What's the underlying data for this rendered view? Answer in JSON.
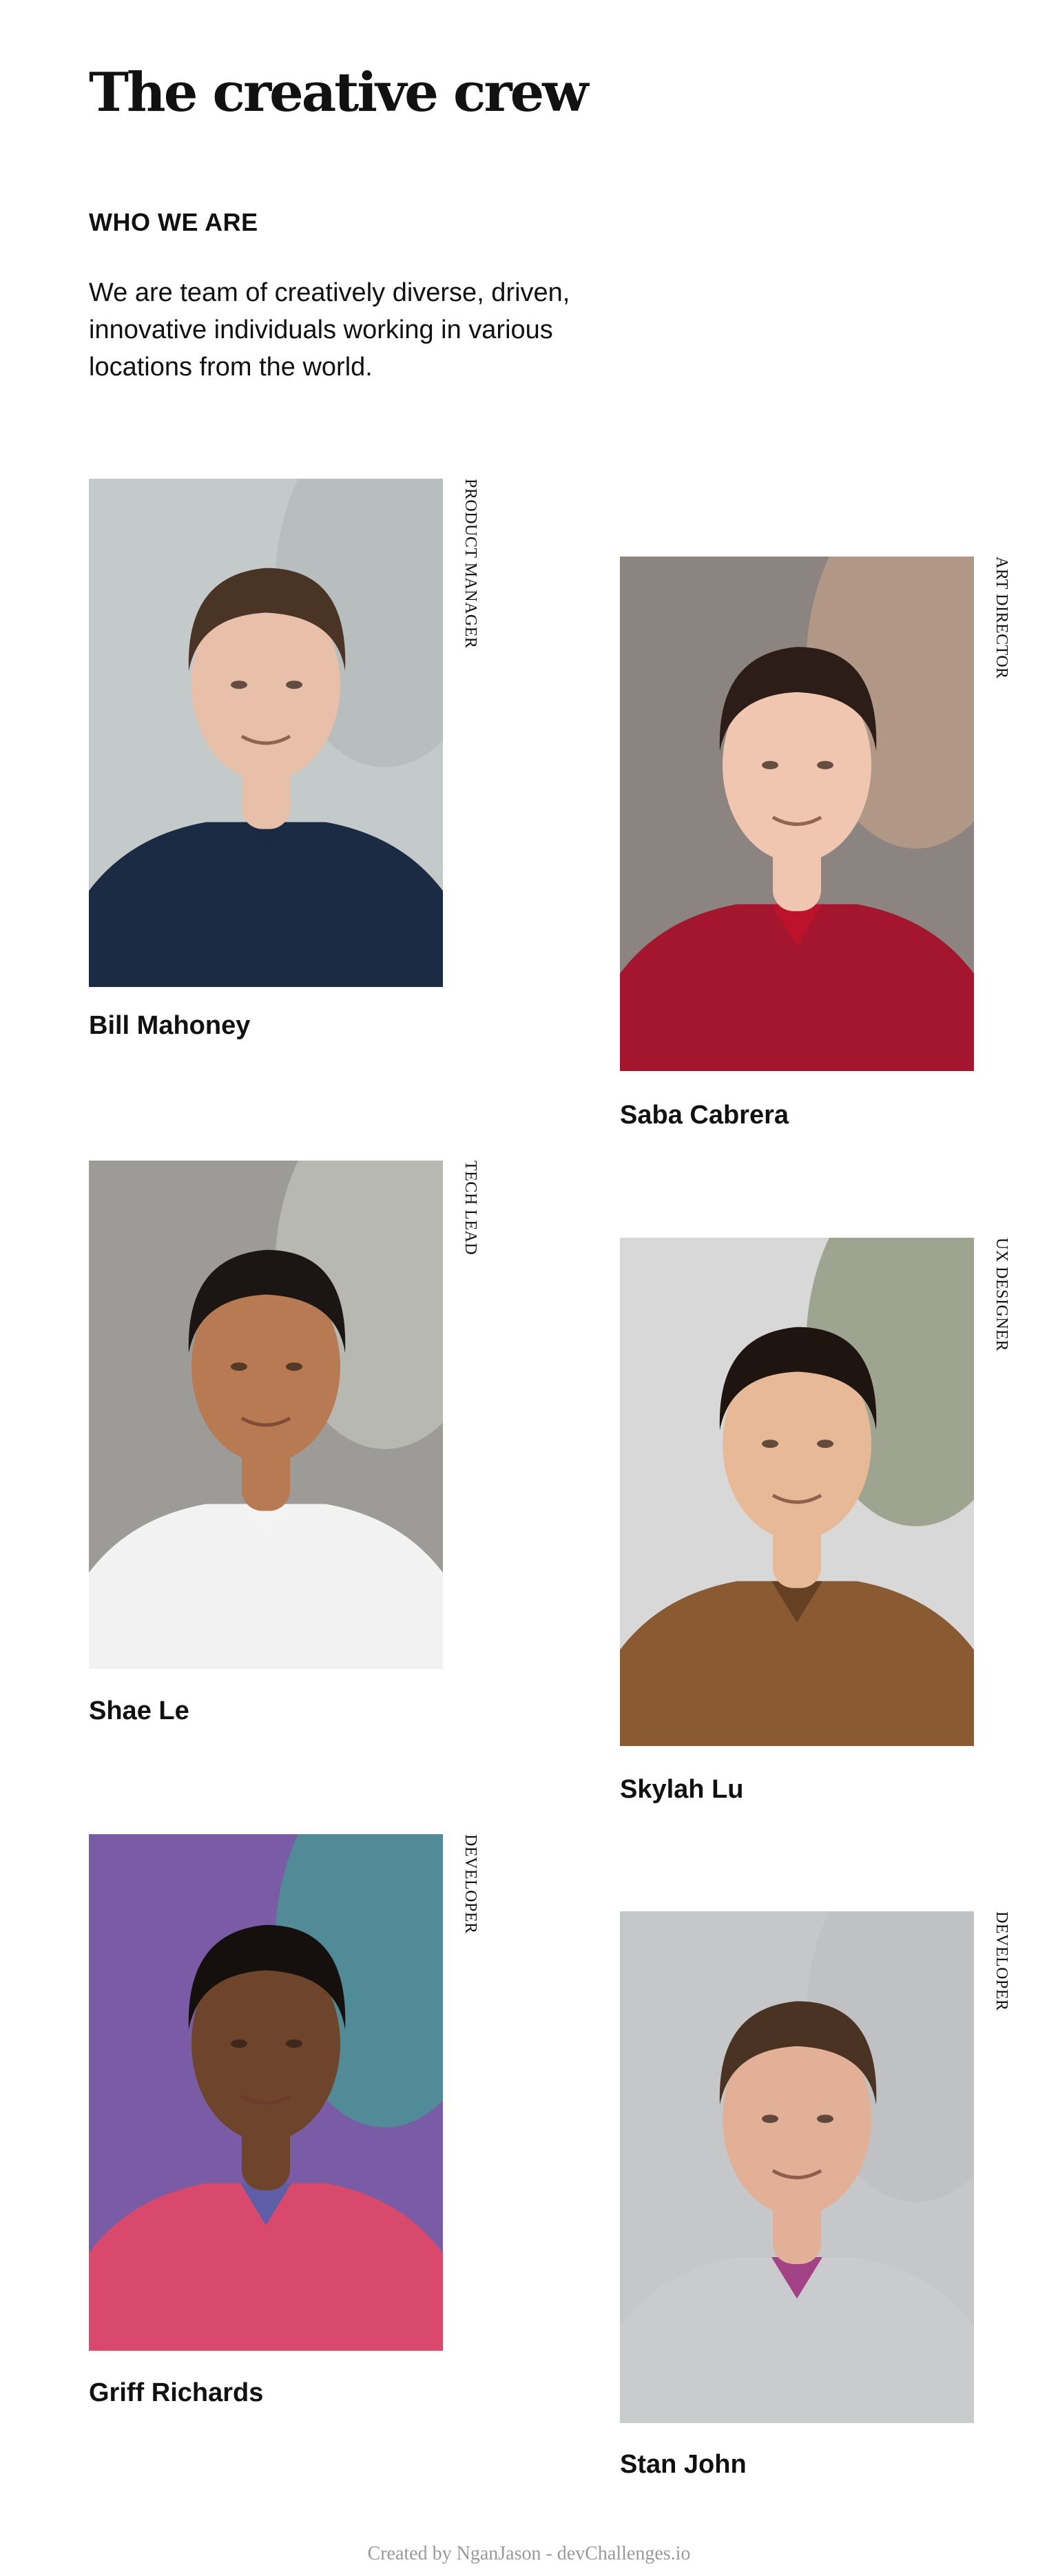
{
  "page": {
    "title": "The creative crew",
    "section_heading": "WHO WE ARE",
    "intro": "We are team of creatively diverse, driven, innovative individuals working in various locations from the world."
  },
  "members": [
    {
      "name": "Bill Mahoney",
      "role": "PRODUCT MANAGER",
      "photo": {
        "bg": "#c4c9c9",
        "bg2": "#aeb4b5",
        "skin": "#e8bfa8",
        "hair": "#4a3426",
        "shirt": "#1c2b44",
        "accent": "#1c2b44"
      }
    },
    {
      "name": "Saba Cabrera",
      "role": "ART DIRECTOR",
      "photo": {
        "bg": "#8c8480",
        "bg2": "#cfa98a",
        "skin": "#f0c6b0",
        "hair": "#2c1d18",
        "shirt": "#a3162d",
        "accent": "#c2122a"
      }
    },
    {
      "name": "Shae Le",
      "role": "TECH LEAD",
      "photo": {
        "bg": "#9c9b98",
        "bg2": "#cfcfcb",
        "skin": "#b77a52",
        "hair": "#1b1613",
        "shirt": "#f2f2f2",
        "accent": "#f2f2f2"
      }
    },
    {
      "name": "Skylah Lu",
      "role": "UX DESIGNER",
      "photo": {
        "bg": "#d9d8d9",
        "bg2": "#6f7a55",
        "skin": "#e8b997",
        "hair": "#1e1511",
        "shirt": "#8a5a32",
        "accent": "#5b3a1f"
      }
    },
    {
      "name": "Griff Richards",
      "role": "DEVELOPER",
      "photo": {
        "bg": "#7a5ba6",
        "bg2": "#2fb38a",
        "skin": "#6e452b",
        "hair": "#15100d",
        "shirt": "#d9496c",
        "accent": "#3f64b8"
      }
    },
    {
      "name": "Stan John",
      "role": "DEVELOPER",
      "photo": {
        "bg": "#c5c7c9",
        "bg2": "#b9bcbe",
        "skin": "#e2b096",
        "hair": "#4a3323",
        "shirt": "#c9cbcd",
        "accent": "#9b1f74"
      }
    }
  ],
  "footer": "Created by NganJason - devChallenges.io"
}
